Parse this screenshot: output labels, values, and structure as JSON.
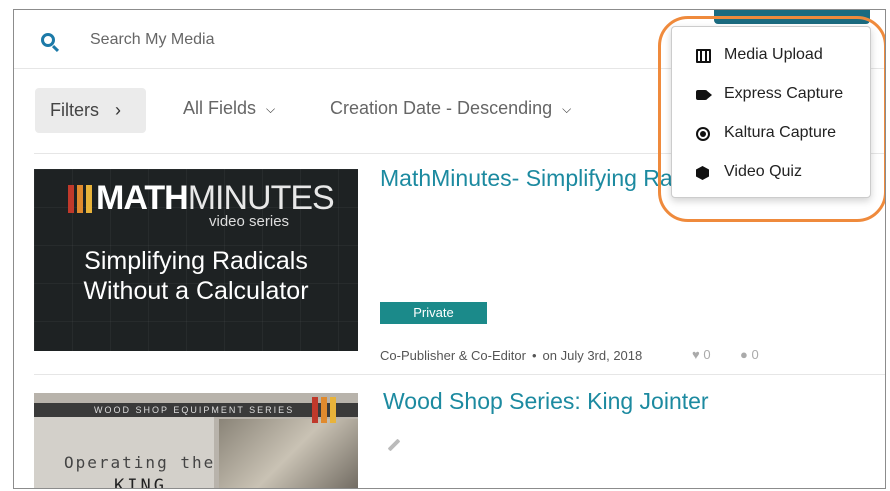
{
  "search": {
    "placeholder": "Search My Media",
    "icon": "search-icon"
  },
  "filters": {
    "filters_label": "Filters",
    "field_select": "All Fields",
    "sort_select": "Creation Date - Descending"
  },
  "add_new_menu": {
    "items": [
      {
        "label": "Media Upload",
        "icon": "film-icon"
      },
      {
        "label": "Express Capture",
        "icon": "video-camera-icon"
      },
      {
        "label": "Kaltura Capture",
        "icon": "record-icon"
      },
      {
        "label": "Video Quiz",
        "icon": "cube-icon"
      }
    ]
  },
  "entries": [
    {
      "title": "MathMinutes- Simplifying Ra",
      "thumbnail": {
        "brand_bold": "MATH",
        "brand_light": "MINUTES",
        "subtitle": "video series",
        "line1": "Simplifying Radicals",
        "line2": "Without a Calculator"
      },
      "badge": "Private",
      "roles": "Co-Publisher & Co-Editor",
      "date": "on July 3rd, 2018",
      "likes": "0",
      "comments": "0"
    },
    {
      "title": "Wood Shop Series: King Jointer",
      "thumbnail": {
        "series": "WOOD SHOP EQUIPMENT SERIES",
        "line1": "Operating the",
        "line2": "KING"
      }
    }
  ],
  "colors": {
    "accent": "#1c8aa0",
    "highlight": "#ef8a3c",
    "badge": "#1b8a8a"
  }
}
